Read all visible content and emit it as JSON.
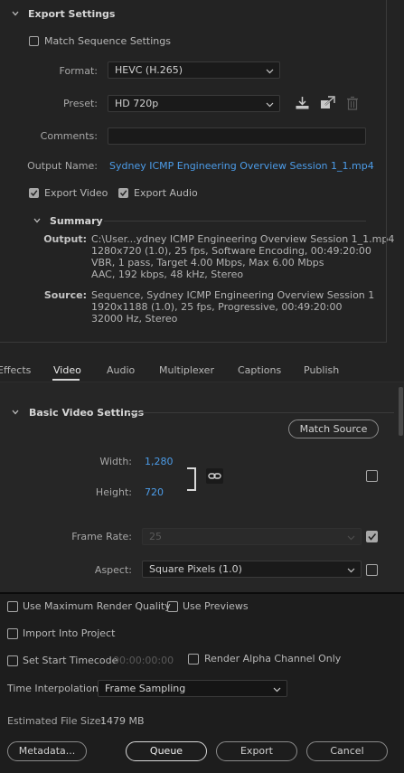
{
  "export_settings": {
    "title": "Export Settings",
    "match_sequence_label": "Match Sequence Settings",
    "format_label": "Format:",
    "format_value": "HEVC (H.265)",
    "preset_label": "Preset:",
    "preset_value": "HD 720p",
    "comments_label": "Comments:",
    "comments_value": "",
    "output_name_label": "Output Name:",
    "output_name_value": "Sydney ICMP Engineering Overview Session 1_1.mp4",
    "export_video_label": "Export Video",
    "export_audio_label": "Export Audio",
    "export_video_checked": true,
    "export_audio_checked": true,
    "match_sequence_checked": false
  },
  "summary": {
    "title": "Summary",
    "output_key": "Output:",
    "output_lines": [
      "C:\\User...ydney ICMP Engineering Overview Session 1_1.mp4",
      "1280x720 (1.0), 25 fps, Software Encoding, 00:49:20:00",
      "VBR, 1 pass, Target 4.00 Mbps, Max 6.00 Mbps",
      "AAC, 192 kbps, 48 kHz, Stereo"
    ],
    "source_key": "Source:",
    "source_lines": [
      "Sequence, Sydney ICMP Engineering Overview Session 1",
      "1920x1188 (1.0), 25 fps, Progressive, 00:49:20:00",
      "32000 Hz, Stereo"
    ]
  },
  "tabs": [
    {
      "label": "Effects",
      "active": false
    },
    {
      "label": "Video",
      "active": true
    },
    {
      "label": "Audio",
      "active": false
    },
    {
      "label": "Multiplexer",
      "active": false
    },
    {
      "label": "Captions",
      "active": false
    },
    {
      "label": "Publish",
      "active": false
    }
  ],
  "basic_video": {
    "title": "Basic Video Settings",
    "match_source_label": "Match Source",
    "width_label": "Width:",
    "width_value": "1,280",
    "height_label": "Height:",
    "height_value": "720",
    "frame_rate_label": "Frame Rate:",
    "frame_rate_value": "25",
    "frame_rate_checked": true,
    "aspect_label": "Aspect:",
    "aspect_value": "Square Pixels (1.0)",
    "aspect_checked": false
  },
  "bottom": {
    "max_render_quality_label": "Use Maximum Render Quality",
    "use_previews_label": "Use Previews",
    "import_into_project_label": "Import Into Project",
    "set_start_timecode_label": "Set Start Timecode",
    "start_timecode_value": "00:00:00:00",
    "render_alpha_label": "Render Alpha Channel Only",
    "time_interpolation_label": "Time Interpolation:",
    "time_interpolation_value": "Frame Sampling",
    "estimated_size_label": "Estimated File Size:",
    "estimated_size_value": "1479 MB",
    "metadata_label": "Metadata...",
    "queue_label": "Queue",
    "export_label": "Export",
    "cancel_label": "Cancel"
  }
}
